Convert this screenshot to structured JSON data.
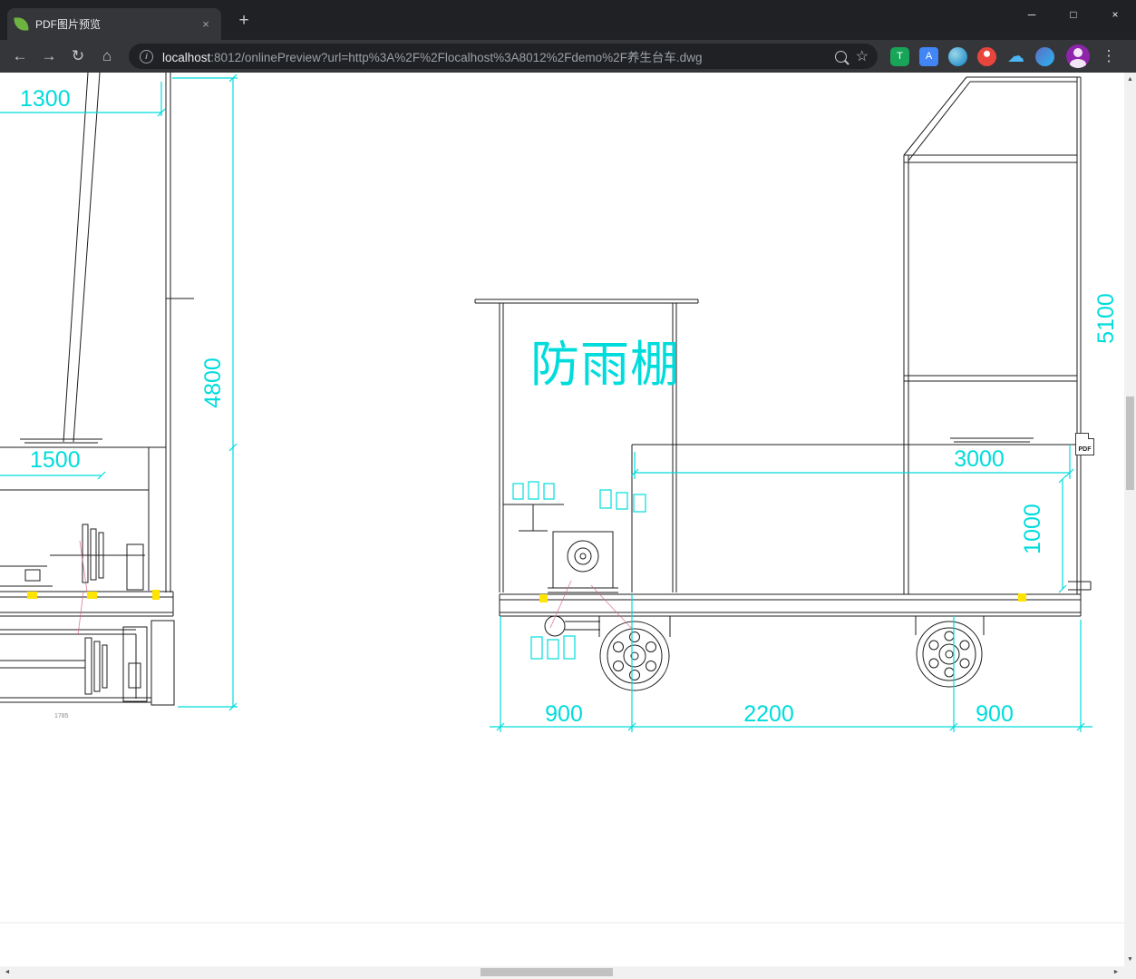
{
  "colors": {
    "chrome-dark": "#202124",
    "toolbar": "#35363a",
    "tab-active": "#35363a",
    "chrome-text": "#e8eaed",
    "chrome-muted": "#9aa0a6",
    "url-muted": "#9aa0a6",
    "icon": "#c4c7c5",
    "cad-line": "#1c1c1c",
    "cad-cyan": "#00dcdc",
    "cad-red": "#d4607a",
    "cad-yellow": "#ffe400",
    "scroll-track": "#f1f1f1",
    "scroll-thumb": "#c1c1c1",
    "favicon-green": "#6db33f"
  },
  "window": {
    "minimize": "─",
    "maximize": "□",
    "close": "×"
  },
  "browser": {
    "tab_title": "PDF图片预览",
    "tab_close": "×",
    "new_tab": "+",
    "nav": {
      "back": "←",
      "forward": "→",
      "reload": "↻",
      "home": "⌂"
    },
    "omnibox": {
      "info": "i",
      "url_host": "localhost",
      "url_rest": ":8012/onlinePreview?url=http%3A%2F%2Flocalhost%3A8012%2Fdemo%2F养生台车.dwg",
      "star": "☆"
    },
    "extensions": [
      "T",
      "A",
      "",
      "",
      "☁",
      ""
    ],
    "menu": "⋮"
  },
  "scrollbar": {
    "up": "▲",
    "down": "▼",
    "left": "◄",
    "right": "►"
  },
  "viewer": {
    "pdf_badge": "PDF"
  },
  "drawing": {
    "shelter_label": "防雨棚",
    "dims": {
      "top_left": "1300",
      "left_height": "4800",
      "left_width": "1500",
      "left_small": "1785",
      "bottom_left": "900",
      "bottom_mid": "2200",
      "bottom_right": "900",
      "deck_width": "3000",
      "deck_height": "1000",
      "mast_height": "5100"
    }
  }
}
